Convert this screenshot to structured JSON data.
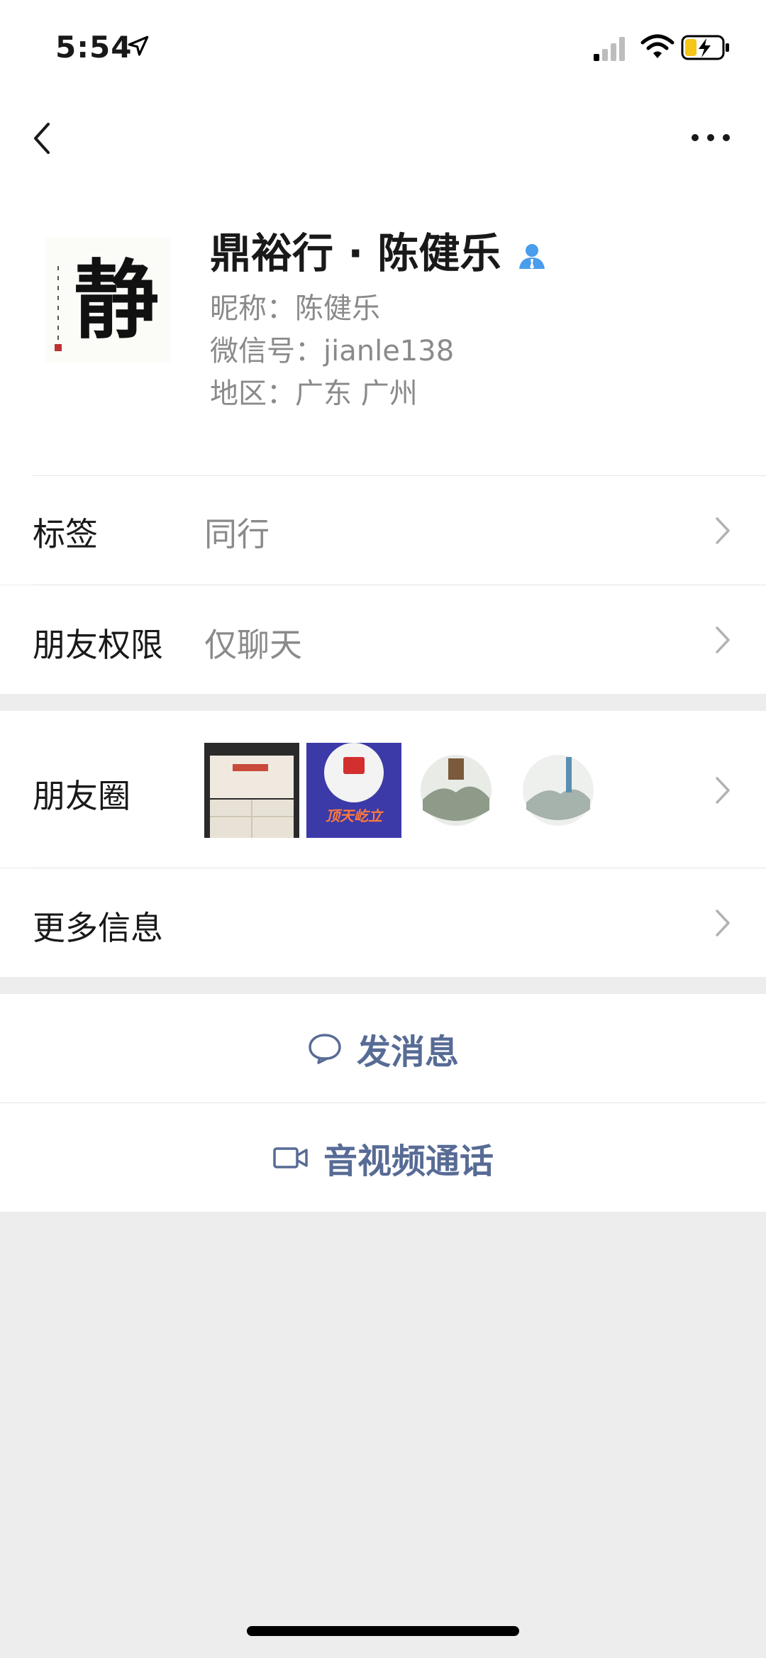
{
  "status": {
    "time": "5:54"
  },
  "profile": {
    "name": "鼎裕行 · 陈健乐",
    "nickname": "昵称：陈健乐",
    "wechat_id": "微信号：jianle138",
    "region": "地区：广东 广州",
    "avatar_char": "静"
  },
  "rows": {
    "tag": {
      "label": "标签",
      "value": "同行"
    },
    "permission": {
      "label": "朋友权限",
      "value": "仅聊天"
    },
    "moments": {
      "label": "朋友圈",
      "thumb2_text": "顶天屹立"
    },
    "more_info": {
      "label": "更多信息"
    }
  },
  "actions": {
    "message": "发消息",
    "call": "音视频通话"
  },
  "colors": {
    "link": "#576b95",
    "verify": "#4a9cec",
    "background": "#ededed"
  }
}
